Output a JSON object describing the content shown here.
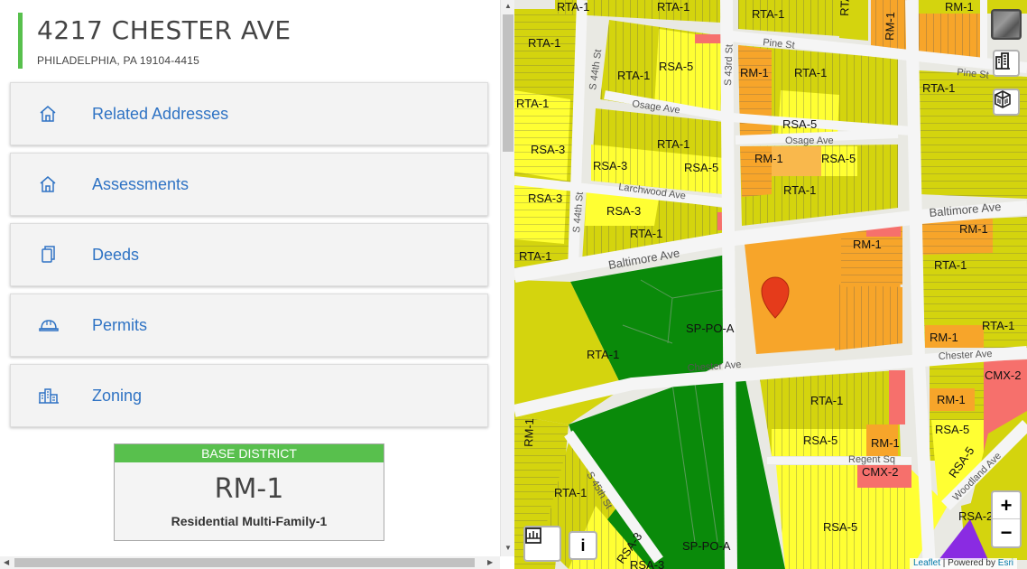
{
  "property": {
    "address": "4217 CHESTER AVE",
    "city_line": "PHILADELPHIA, PA 19104-4415"
  },
  "accordions": [
    {
      "label": "Related Addresses",
      "icon": "home-icon"
    },
    {
      "label": "Assessments",
      "icon": "home-icon"
    },
    {
      "label": "Deeds",
      "icon": "documents-icon"
    },
    {
      "label": "Permits",
      "icon": "hard-hat-icon"
    },
    {
      "label": "Zoning",
      "icon": "buildings-icon"
    }
  ],
  "zoning": {
    "header": "BASE DISTRICT",
    "code": "RM-1",
    "description": "Residential Multi-Family-1"
  },
  "map": {
    "zoom_in": "+",
    "zoom_out": "−",
    "info_button": "i",
    "attribution_leaflet": "Leaflet",
    "attribution_sep": " | Powered by ",
    "attribution_esri": "Esri",
    "streets": [
      "Pine St",
      "Pine St",
      "Osage Ave",
      "Osage Ave",
      "Larchwood Ave",
      "Baltimore Ave",
      "Baltimore Ave",
      "Chester Ave",
      "Chester Ave",
      "Regent Sq",
      "Woodland Ave",
      "S 44th St",
      "S 44th St",
      "S 43rd St",
      "S 45th St"
    ],
    "zone_labels": [
      "RTA-1",
      "RTA-1",
      "RTA-1",
      "RM-1",
      "RM-1",
      "RTA-1",
      "RSA-5",
      "RTA-1",
      "RM-1",
      "RTA-1",
      "RTA-1",
      "RSA-5",
      "RTA-1",
      "RSA-3",
      "RSA-5",
      "RTA-1",
      "RSA-3",
      "RSA-5",
      "RM-1",
      "RTA-1",
      "RSA-3",
      "RSA-3",
      "RTA-1",
      "RTA-1",
      "RM-1",
      "RM-1",
      "RTA-1",
      "SP-PO-A",
      "RTA-1",
      "RM-1",
      "RTA-1",
      "RTA-1",
      "CMX-2",
      "RM-1",
      "RSA-5",
      "RM-1",
      "RSA-5",
      "CMX-2",
      "RSA-5",
      "RTA-1",
      "RSA-3",
      "RSA-2",
      "RSA-5",
      "RSA-3",
      "SP-PO-A",
      "RM-1",
      "RTA-1"
    ],
    "colors": {
      "rta": "#d4d40e",
      "rsa5": "#ffff33",
      "rm": "#f7a52a",
      "rm_light": "#f9b84c",
      "sp": "#0a8a0a",
      "cmx": "#f6706c",
      "road": "#f5f5f5",
      "purple": "#8a2be2",
      "marker": "#e53b1b"
    }
  }
}
